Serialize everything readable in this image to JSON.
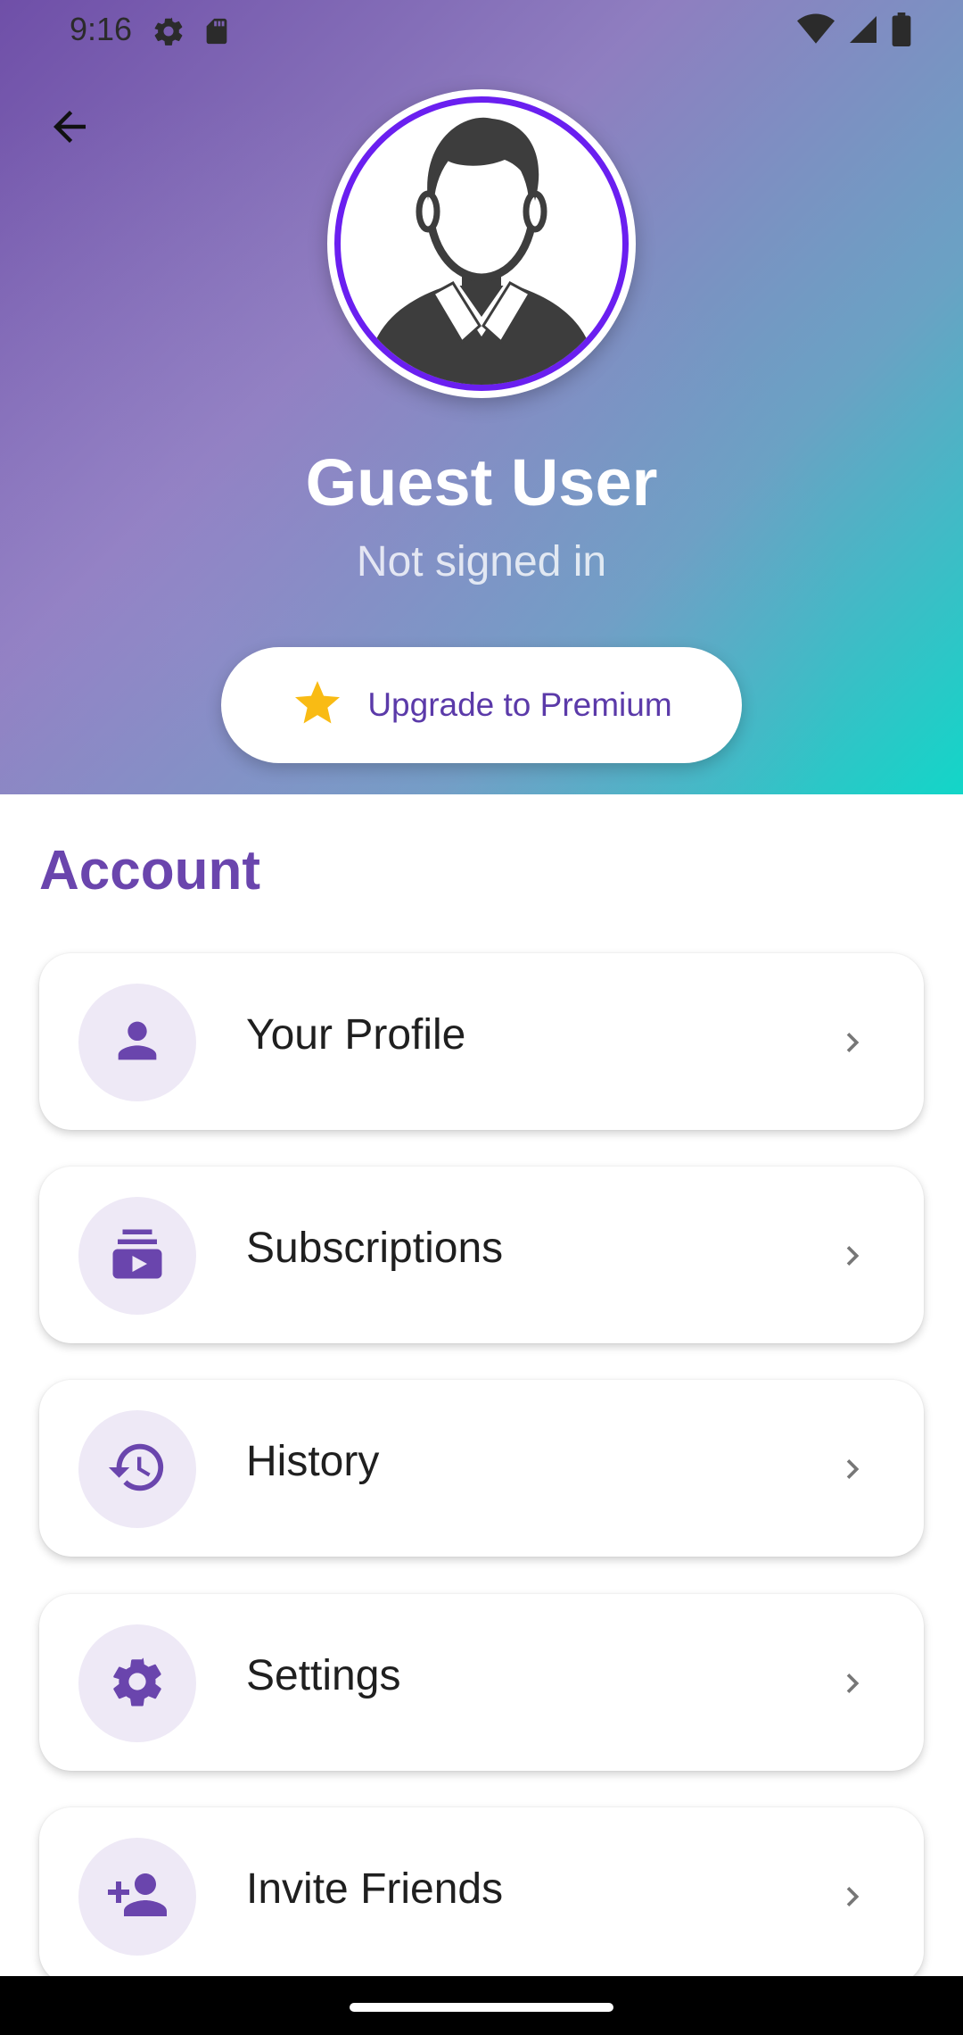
{
  "status_bar": {
    "time": "9:16",
    "left_icons": [
      "settings-icon",
      "sd-card-icon"
    ],
    "right_icons": [
      "wifi-icon",
      "signal-icon",
      "battery-icon"
    ]
  },
  "header": {
    "back_icon": "arrow-back-icon"
  },
  "profile": {
    "name": "Guest User",
    "status": "Not signed in",
    "avatar_icon": "user-avatar-icon",
    "avatar_ring_color": "#6a1ff0"
  },
  "premium": {
    "label": "Upgrade to Premium",
    "icon": "star-icon",
    "icon_color": "#f9bb14"
  },
  "account": {
    "title": "Account",
    "items": [
      {
        "label": "Your Profile",
        "icon": "person-icon"
      },
      {
        "label": "Subscriptions",
        "icon": "subscriptions-icon"
      },
      {
        "label": "History",
        "icon": "history-icon"
      },
      {
        "label": "Settings",
        "icon": "gear-icon"
      },
      {
        "label": "Invite Friends",
        "icon": "person-add-icon"
      }
    ]
  },
  "colors": {
    "accent": "#6a45ad",
    "icon_bg": "#eee9f6",
    "gradient_start": "#6f4fa8",
    "gradient_end": "#12d6c8"
  }
}
